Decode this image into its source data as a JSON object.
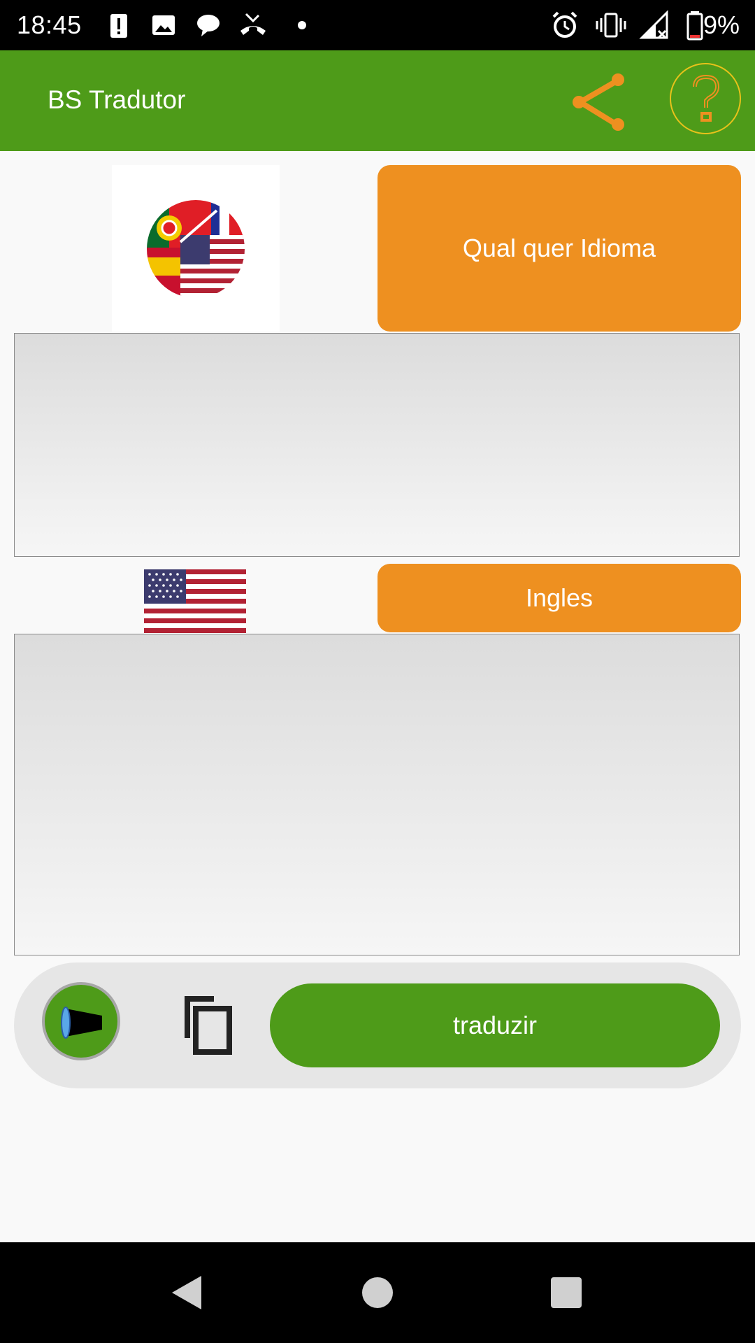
{
  "status_bar": {
    "time": "18:45",
    "battery_percent": "9%",
    "left_icons": [
      "alert-icon",
      "image-icon",
      "chat-bubble-icon",
      "missed-call-icon",
      "dot-icon"
    ],
    "right_icons": [
      "alarm-icon",
      "vibrate-icon",
      "signal-icon",
      "battery-icon"
    ]
  },
  "app_bar": {
    "title": "BS Tradutor",
    "actions": [
      "share-icon",
      "help-icon"
    ]
  },
  "source": {
    "language_button": "Qual quer Idioma",
    "text_value": "",
    "flag_icon": "multi-language-flags-icon"
  },
  "target": {
    "language_button": "Ingles",
    "text_value": "",
    "flag_icon": "us-flag-icon"
  },
  "actions": {
    "translate_label": "traduzir",
    "speak_icon": "speaker-icon",
    "copy_icon": "copy-icon"
  },
  "colors": {
    "primary_green": "#4e9b19",
    "accent_orange": "#ee9020",
    "help_ring": "#e8c21a"
  },
  "nav_bar": [
    "back-icon",
    "home-icon",
    "recents-icon"
  ]
}
